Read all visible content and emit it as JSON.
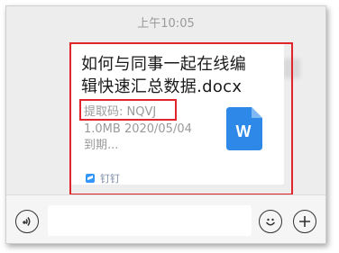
{
  "chat": {
    "timestamp": "上午10:05"
  },
  "message": {
    "file_title": "如何与同事一起在线编辑快速汇总数据.docx",
    "extract_code": "提取码: NQVJ",
    "size_date": "1.0MB 2020/05/04",
    "expiry": "到期...",
    "source_app": "钉钉",
    "file_icon": "word-doc-icon",
    "file_icon_letter": "W",
    "colors": {
      "file_icon": "#2d88e8",
      "highlight": "#e0252b",
      "source_logo": "#3296fa"
    }
  },
  "input_bar": {
    "voice_icon": "voice-icon",
    "emoji_icon": "emoji-icon",
    "plus_icon": "plus-icon",
    "text_value": ""
  }
}
